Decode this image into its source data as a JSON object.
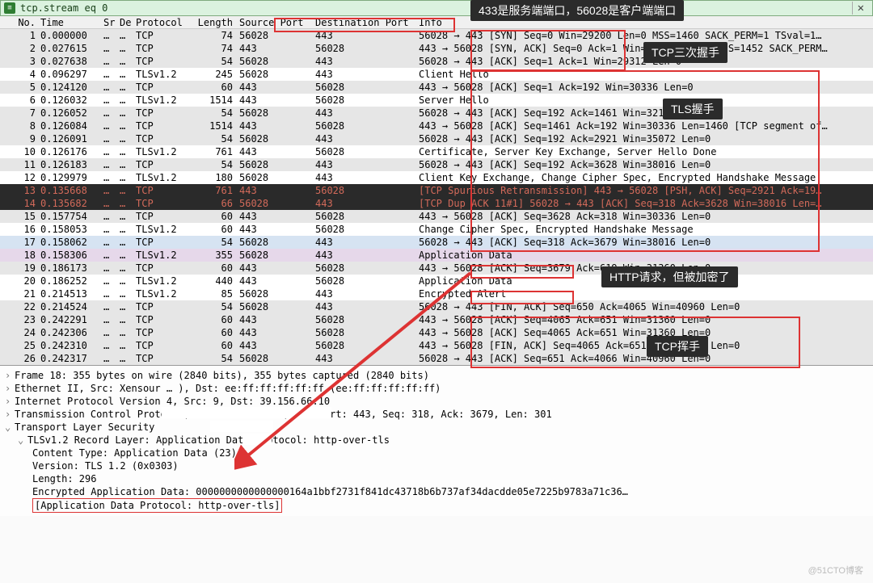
{
  "filter": {
    "text": "tcp.stream eq 0",
    "icon": "✕"
  },
  "columns": {
    "no": "No.",
    "time": "Time",
    "src": "Sr",
    "dst": "De",
    "proto": "Protocol",
    "len": "Length",
    "sport": "Source Port",
    "dport": "Destination Port",
    "info": "Info"
  },
  "rows": [
    {
      "no": 1,
      "time": "0.000000",
      "src": "…",
      "dst": "…",
      "proto": "TCP",
      "len": 74,
      "sport": "56028",
      "dport": "443",
      "info": "56028 → 443 [SYN] Seq=0 Win=29200 Len=0 MSS=1460 SACK_PERM=1 TSval=1…",
      "cls": "row-g"
    },
    {
      "no": 2,
      "time": "0.027615",
      "src": "…",
      "dst": "…",
      "proto": "TCP",
      "len": 74,
      "sport": "443",
      "dport": "56028",
      "info": "443 → 56028 [SYN, ACK] Seq=0 Ack=1 Win=14600 Len=0 MSS=1452 SACK_PERM…",
      "cls": "row-g"
    },
    {
      "no": 3,
      "time": "0.027638",
      "src": "…",
      "dst": "…",
      "proto": "TCP",
      "len": 54,
      "sport": "56028",
      "dport": "443",
      "info": "56028 → 443 [ACK] Seq=1 Ack=1 Win=29312 Len=0",
      "cls": "row-g"
    },
    {
      "no": 4,
      "time": "0.096297",
      "src": "…",
      "dst": "…",
      "proto": "TLSv1.2",
      "len": 245,
      "sport": "56028",
      "dport": "443",
      "info": "Client Hello",
      "cls": "row-n"
    },
    {
      "no": 5,
      "time": "0.124120",
      "src": "…",
      "dst": "…",
      "proto": "TCP",
      "len": 60,
      "sport": "443",
      "dport": "56028",
      "info": "443 → 56028 [ACK] Seq=1 Ack=192 Win=30336 Len=0",
      "cls": "row-g"
    },
    {
      "no": 6,
      "time": "0.126032",
      "src": "…",
      "dst": "…",
      "proto": "TLSv1.2",
      "len": 1514,
      "sport": "443",
      "dport": "56028",
      "info": "Server Hello",
      "cls": "row-n"
    },
    {
      "no": 7,
      "time": "0.126052",
      "src": "…",
      "dst": "…",
      "proto": "TCP",
      "len": 54,
      "sport": "56028",
      "dport": "443",
      "info": "56028 → 443 [ACK] Seq=192 Ack=1461 Win=32128 Len=0",
      "cls": "row-g"
    },
    {
      "no": 8,
      "time": "0.126084",
      "src": "…",
      "dst": "…",
      "proto": "TCP",
      "len": 1514,
      "sport": "443",
      "dport": "56028",
      "info": "443 → 56028 [ACK] Seq=1461 Ack=192 Win=30336 Len=1460 [TCP segment of…",
      "cls": "row-g"
    },
    {
      "no": 9,
      "time": "0.126091",
      "src": "…",
      "dst": "…",
      "proto": "TCP",
      "len": 54,
      "sport": "56028",
      "dport": "443",
      "info": "56028 → 443 [ACK] Seq=192 Ack=2921 Win=35072 Len=0",
      "cls": "row-g"
    },
    {
      "no": 10,
      "time": "0.126176",
      "src": "…",
      "dst": "…",
      "proto": "TLSv1.2",
      "len": 761,
      "sport": "443",
      "dport": "56028",
      "info": "Certificate, Server Key Exchange, Server Hello Done",
      "cls": "row-n"
    },
    {
      "no": 11,
      "time": "0.126183",
      "src": "…",
      "dst": "…",
      "proto": "TCP",
      "len": 54,
      "sport": "56028",
      "dport": "443",
      "info": "56028 → 443 [ACK] Seq=192 Ack=3628 Win=38016 Len=0",
      "cls": "row-g"
    },
    {
      "no": 12,
      "time": "0.129979",
      "src": "…",
      "dst": "…",
      "proto": "TLSv1.2",
      "len": 180,
      "sport": "56028",
      "dport": "443",
      "info": "Client Key Exchange, Change Cipher Spec, Encrypted Handshake Message",
      "cls": "row-n"
    },
    {
      "no": 13,
      "time": "0.135668",
      "src": "…",
      "dst": "…",
      "proto": "TCP",
      "len": 761,
      "sport": "443",
      "dport": "56028",
      "info": "[TCP Spurious Retransmission] 443 → 56028 [PSH, ACK] Seq=2921 Ack=19…",
      "cls": "row-red"
    },
    {
      "no": 14,
      "time": "0.135682",
      "src": "…",
      "dst": "…",
      "proto": "TCP",
      "len": 66,
      "sport": "56028",
      "dport": "443",
      "info": "[TCP Dup ACK 11#1] 56028 → 443 [ACK] Seq=318 Ack=3628 Win=38016 Len=…",
      "cls": "row-red"
    },
    {
      "no": 15,
      "time": "0.157754",
      "src": "…",
      "dst": "…",
      "proto": "TCP",
      "len": 60,
      "sport": "443",
      "dport": "56028",
      "info": "443 → 56028 [ACK] Seq=3628 Ack=318 Win=30336 Len=0",
      "cls": "row-g"
    },
    {
      "no": 16,
      "time": "0.158053",
      "src": "…",
      "dst": "…",
      "proto": "TLSv1.2",
      "len": 60,
      "sport": "443",
      "dport": "56028",
      "info": "Change Cipher Spec, Encrypted Handshake Message",
      "cls": "row-n"
    },
    {
      "no": 17,
      "time": "0.158062",
      "src": "…",
      "dst": "…",
      "proto": "TCP",
      "len": 54,
      "sport": "56028",
      "dport": "443",
      "info": "56028 → 443 [ACK] Seq=318 Ack=3679 Win=38016 Len=0",
      "cls": "row-blue"
    },
    {
      "no": 18,
      "time": "0.158306",
      "src": "…",
      "dst": "…",
      "proto": "TLSv1.2",
      "len": 355,
      "sport": "56028",
      "dport": "443",
      "info": "Application Data",
      "cls": "row-purple"
    },
    {
      "no": 19,
      "time": "0.186173",
      "src": "…",
      "dst": "…",
      "proto": "TCP",
      "len": 60,
      "sport": "443",
      "dport": "56028",
      "info": "443 → 56028 [ACK] Seq=3679 Ack=619 Win=31360 Len=0",
      "cls": "row-g"
    },
    {
      "no": 20,
      "time": "0.186252",
      "src": "…",
      "dst": "…",
      "proto": "TLSv1.2",
      "len": 440,
      "sport": "443",
      "dport": "56028",
      "info": "Application Data",
      "cls": "row-n"
    },
    {
      "no": 21,
      "time": "0.214513",
      "src": "…",
      "dst": "…",
      "proto": "TLSv1.2",
      "len": 85,
      "sport": "56028",
      "dport": "443",
      "info": "Encrypted Alert",
      "cls": "row-n"
    },
    {
      "no": 22,
      "time": "0.214524",
      "src": "…",
      "dst": "…",
      "proto": "TCP",
      "len": 54,
      "sport": "56028",
      "dport": "443",
      "info": "56028 → 443 [FIN, ACK] Seq=650 Ack=4065 Win=40960 Len=0",
      "cls": "row-g"
    },
    {
      "no": 23,
      "time": "0.242291",
      "src": "…",
      "dst": "…",
      "proto": "TCP",
      "len": 60,
      "sport": "443",
      "dport": "56028",
      "info": "443 → 56028 [ACK] Seq=4065 Ack=651 Win=31360 Len=0",
      "cls": "row-g"
    },
    {
      "no": 24,
      "time": "0.242306",
      "src": "…",
      "dst": "…",
      "proto": "TCP",
      "len": 60,
      "sport": "443",
      "dport": "56028",
      "info": "443 → 56028 [ACK] Seq=4065 Ack=651 Win=31360 Len=0",
      "cls": "row-g"
    },
    {
      "no": 25,
      "time": "0.242310",
      "src": "…",
      "dst": "…",
      "proto": "TCP",
      "len": 60,
      "sport": "443",
      "dport": "56028",
      "info": "443 → 56028 [FIN, ACK] Seq=4065 Ack=651 Win=31360 Len=0",
      "cls": "row-g"
    },
    {
      "no": 26,
      "time": "0.242317",
      "src": "…",
      "dst": "…",
      "proto": "TCP",
      "len": 54,
      "sport": "56028",
      "dport": "443",
      "info": "56028 → 443 [ACK] Seq=651 Ack=4066 Win=40960 Len=0",
      "cls": "row-g"
    }
  ],
  "details": {
    "l0": "Frame 18: 355 bytes on wire (2840 bits), 355 bytes captured (2840 bits)",
    "l1a": "Ethernet II, Src: Xensour  …                  ), Dst: ee:ff:ff:ff:ff:ff (ee:ff:ff:ff:ff:ff)",
    "l2": "Internet Protocol Version 4, Src:             9, Dst: 39.156.66.10",
    "l3": "Transmission Control Protocol, Src Port: 56028, Dst Port: 443, Seq: 318, Ack: 3679, Len: 301",
    "l4": "Transport Layer Security",
    "l5": "TLSv1.2 Record Layer: Application Data Protocol: http-over-tls",
    "l6": "Content Type: Application Data (23)",
    "l7": "Version: TLS 1.2 (0x0303)",
    "l8": "Length: 296",
    "l9": "Encrypted Application Data: 0000000000000000164a1bbf2731f841dc43718b6b737af34dacdde05e7225b9783a71c36…",
    "l10": "[Application Data Protocol: http-over-tls]"
  },
  "annos": {
    "a1": "433是服务端端口，56028是客户端端口",
    "a2": "TCP三次握手",
    "a3": "TLS握手",
    "a4": "HTTP请求，但被加密了",
    "a5": "TCP挥手"
  },
  "watermark": "@51CTO博客"
}
